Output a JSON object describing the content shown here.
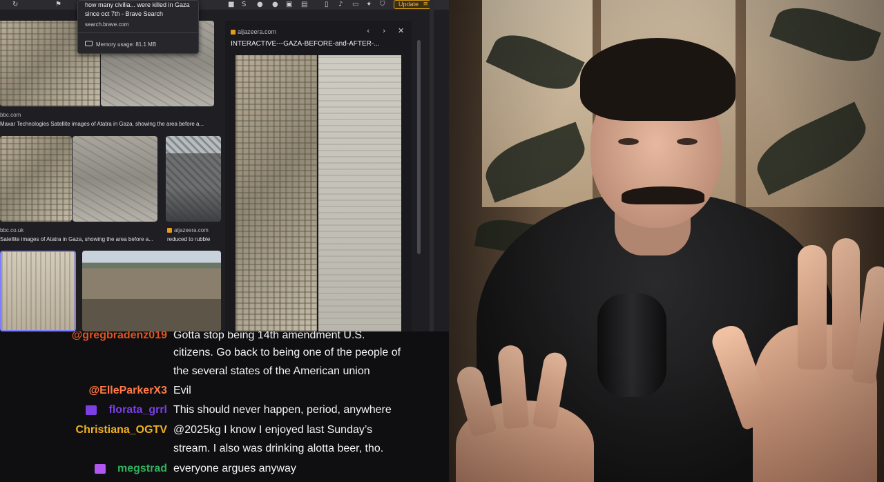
{
  "browser": {
    "tab_tooltip": {
      "title": "how many civilia... were killed in Gaza since oct 7th - Brave Search",
      "url": "search.brave.com",
      "memory": "Memory usage: 81.1 MB"
    },
    "update_label": "Update",
    "results": [
      {
        "source": "bbc.com",
        "caption": "Maxar Technologies Satellite images of Atatra in Gaza, showing the area before a..."
      },
      {
        "source": "bbc.co.uk",
        "caption": "Satellite images of Atatra in Gaza, showing the area before a..."
      },
      {
        "source": "aljazeera.com",
        "caption": "reduced to rubble"
      }
    ],
    "preview": {
      "source": "aljazeera.com",
      "title": "INTERACTIVE---GAZA-BEFORE-and-AFTER-..."
    }
  },
  "chat": {
    "messages": [
      {
        "user": "@gregbradenz019",
        "user_color": "#e0541f",
        "text": "Gotta stop being 14th amendment U.S."
      },
      {
        "user": "",
        "user_color": "#ffffff",
        "text": "citizens. Go back to being one of the people of"
      },
      {
        "user": "",
        "user_color": "#ffffff",
        "text": "the several states of the American union"
      },
      {
        "user": "@ElleParkerX3",
        "user_color": "#ff7a45",
        "text": "Evil"
      },
      {
        "user": "florata_grrl",
        "user_color": "#7b3fe4",
        "text": "This should never happen, period, anywhere",
        "badge_color": "#7b3fe4"
      },
      {
        "user": "Christiana_OGTV",
        "user_color": "#f0b21f",
        "text": "@2025kg I know I enjoyed last Sunday’s"
      },
      {
        "user": "",
        "user_color": "#ffffff",
        "text": "stream. I also was drinking alotta beer, tho."
      },
      {
        "user": "megstrad",
        "user_color": "#2fb25a",
        "text": "everyone argues anyway",
        "badge_color": "#b157f0"
      }
    ]
  },
  "colors": {
    "update_accent": "#f0b23a",
    "chat_bg": "#0f0f12"
  }
}
